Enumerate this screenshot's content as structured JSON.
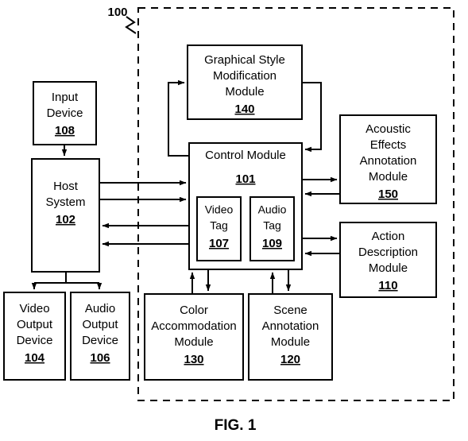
{
  "figure": {
    "caption": "FIG. 1",
    "system_reference_numeral": "100"
  },
  "boxes": {
    "input_device": {
      "lines": [
        "Input",
        "Device"
      ],
      "num": "108"
    },
    "host_system": {
      "lines": [
        "Host",
        "System"
      ],
      "num": "102"
    },
    "video_output_device": {
      "lines": [
        "Video",
        "Output",
        "Device"
      ],
      "num": "104"
    },
    "audio_output_device": {
      "lines": [
        "Audio",
        "Output",
        "Device"
      ],
      "num": "106"
    },
    "graphical_style_modification_module": {
      "lines": [
        "Graphical Style",
        "Modification",
        "Module"
      ],
      "num": "140"
    },
    "control_module": {
      "lines": [
        "Control Module"
      ],
      "num": "101"
    },
    "video_tag": {
      "lines": [
        "Video",
        "Tag"
      ],
      "num": "107"
    },
    "audio_tag": {
      "lines": [
        "Audio",
        "Tag"
      ],
      "num": "109"
    },
    "acoustic_effects_annotation_module": {
      "lines": [
        "Acoustic",
        "Effects",
        "Annotation",
        "Module"
      ],
      "num": "150"
    },
    "action_description_module": {
      "lines": [
        "Action",
        "Description",
        "Module"
      ],
      "num": "110"
    },
    "color_accommodation_module": {
      "lines": [
        "Color",
        "Accommodation",
        "Module"
      ],
      "num": "130"
    },
    "scene_annotation_module": {
      "lines": [
        "Scene",
        "Annotation",
        "Module"
      ],
      "num": "120"
    }
  },
  "colors": {
    "stroke": "#000000",
    "fill": "#ffffff"
  }
}
